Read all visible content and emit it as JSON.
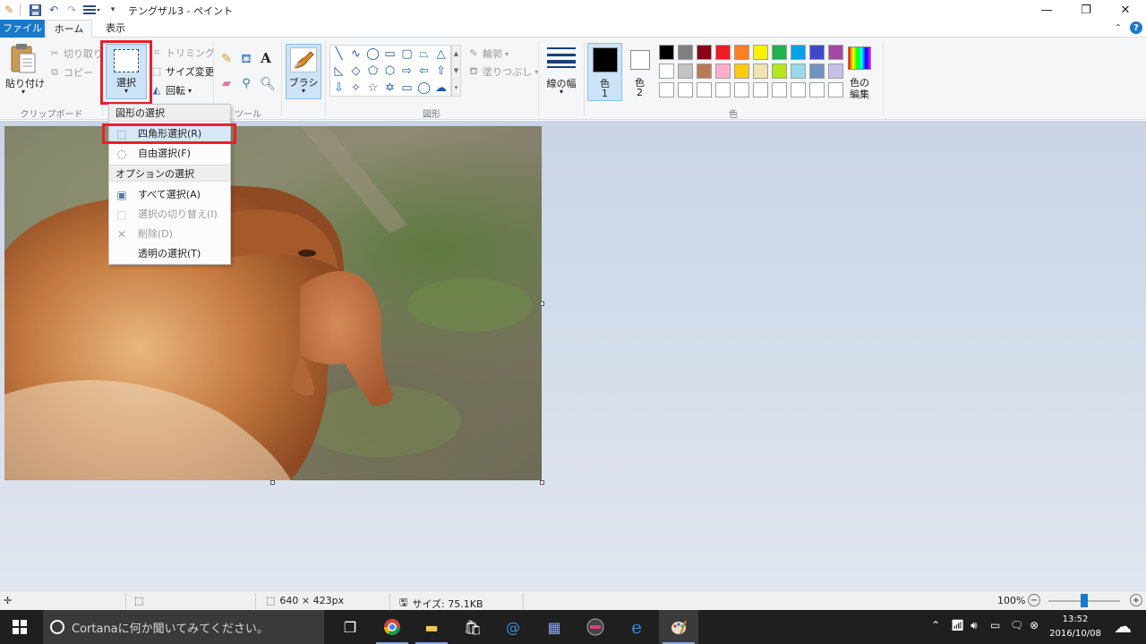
{
  "window": {
    "title": "テングザル3 - ペイント",
    "minimize_glyph": "—",
    "restore_glyph": "❐",
    "close_glyph": "✕"
  },
  "tabs": {
    "file": "ファイル",
    "home": "ホーム",
    "view": "表示"
  },
  "clipboard": {
    "paste": "貼り付け",
    "cut": "切り取り",
    "copy": "コピー",
    "group_label": "クリップボード"
  },
  "image": {
    "select": "選択",
    "crop": "トリミング",
    "resize": "サイズ変更",
    "rotate": "回転"
  },
  "tools": {
    "group_label": "ツール",
    "brush": "ブラシ"
  },
  "shapes": {
    "group_label": "図形",
    "outline": "輪郭",
    "fill": "塗りつぶし"
  },
  "size": {
    "label": "線の幅"
  },
  "colors": {
    "color1_label": "色",
    "color1_num": "1",
    "color2_label": "色",
    "color2_num": "2",
    "edit_label_1": "色の",
    "edit_label_2": "編集",
    "group_label": "色",
    "color1_value": "#000000",
    "color2_value": "#ffffff",
    "palette_row1": [
      "#000000",
      "#7f7f7f",
      "#880015",
      "#ed1c24",
      "#ff7f27",
      "#fff200",
      "#22b14c",
      "#00a2e8",
      "#3f48cc",
      "#a349a4"
    ],
    "palette_row2": [
      "#ffffff",
      "#c3c3c3",
      "#b97a57",
      "#ffaec9",
      "#ffc90e",
      "#efe4b0",
      "#b5e61d",
      "#99d9ea",
      "#7092be",
      "#c8bfe7"
    ],
    "palette_row3": [
      "#ffffff",
      "#ffffff",
      "#ffffff",
      "#ffffff",
      "#ffffff",
      "#ffffff",
      "#ffffff",
      "#ffffff",
      "#ffffff",
      "#ffffff"
    ]
  },
  "dropdown": {
    "shape_header": "図形の選択",
    "rect_select": "四角形選択(R)",
    "free_select": "自由選択(F)",
    "options_header": "オプションの選択",
    "select_all": "すべて選択(A)",
    "invert_select": "選択の切り替え(I)",
    "delete": "削除(D)",
    "transparent_select": "透明の選択(T)"
  },
  "status": {
    "dimensions": "640 × 423px",
    "file_size": "サイズ: 75.1KB",
    "zoom": "100%"
  },
  "taskbar": {
    "cortana_placeholder": "Cortanaに何か聞いてみてください。",
    "time": "13:52",
    "date": "2016/10/08"
  }
}
